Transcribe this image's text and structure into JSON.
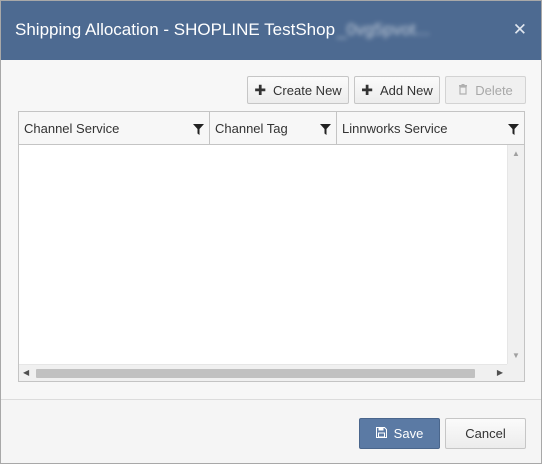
{
  "dialog": {
    "title": "Shipping Allocation - SHOPLINE TestShop",
    "title_suffix_obscured": "_0vg5pvot...",
    "close_icon": "close-icon"
  },
  "toolbar": {
    "create_new_label": "Create New",
    "add_new_label": "Add New",
    "delete_label": "Delete",
    "delete_disabled": true
  },
  "grid": {
    "columns": [
      "Channel Service",
      "Channel Tag",
      "Linnworks Service"
    ],
    "rows": []
  },
  "footer": {
    "save_label": "Save",
    "cancel_label": "Cancel"
  },
  "colors": {
    "header_bg": "#4d6a91",
    "save_bg": "#5b7aa4"
  }
}
